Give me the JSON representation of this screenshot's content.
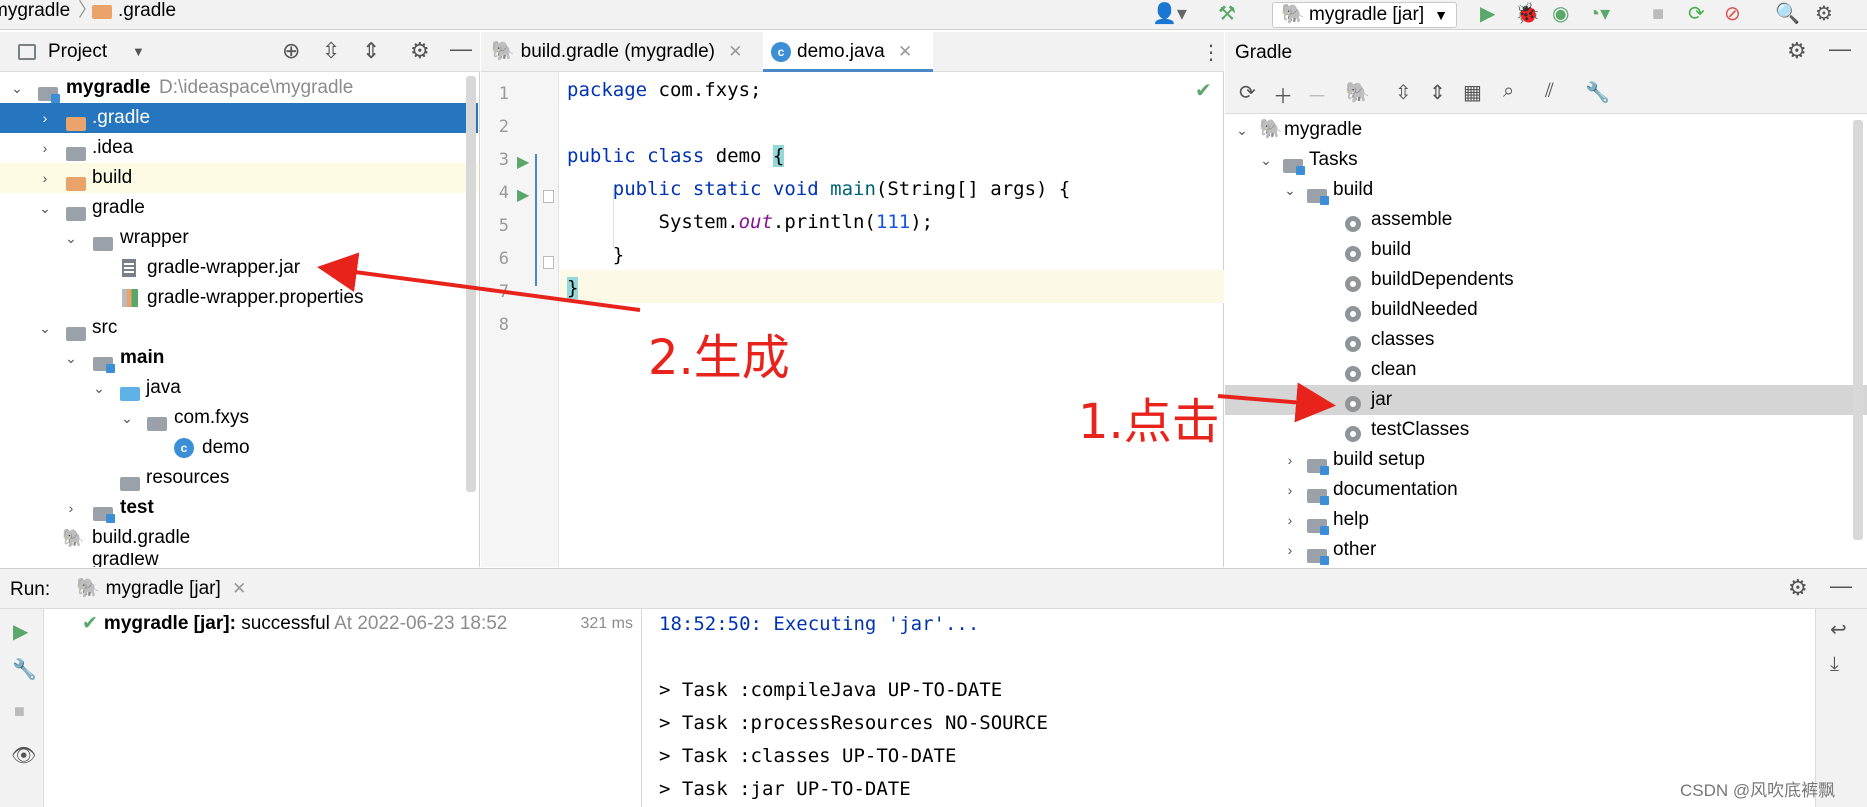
{
  "breadcrumb": {
    "project": "mygradle",
    "folder": ".gradle"
  },
  "toolbar": {
    "run_config": "mygradle [jar]"
  },
  "project_panel": {
    "title": "Project",
    "root_name": "mygradle",
    "root_path": "D:\\ideaspace\\mygradle",
    "items": [
      {
        "label": ".gradle"
      },
      {
        "label": ".idea"
      },
      {
        "label": "build"
      },
      {
        "label": "gradle"
      },
      {
        "label": "wrapper"
      },
      {
        "label": "gradle-wrapper.jar"
      },
      {
        "label": "gradle-wrapper.properties"
      },
      {
        "label": "src"
      },
      {
        "label": "main"
      },
      {
        "label": "java"
      },
      {
        "label": "com.fxys"
      },
      {
        "label": "demo"
      },
      {
        "label": "resources"
      },
      {
        "label": "test"
      },
      {
        "label": "build.gradle"
      },
      {
        "label": "gradlew"
      }
    ]
  },
  "editor": {
    "tabs": [
      {
        "label": "build.gradle (mygradle)"
      },
      {
        "label": "demo.java"
      }
    ],
    "line_numbers": [
      "1",
      "2",
      "3",
      "4",
      "5",
      "6",
      "7",
      "8"
    ]
  },
  "gradle_panel": {
    "title": "Gradle",
    "root": "mygradle",
    "tasks_label": "Tasks",
    "build_group": "build",
    "build_tasks": [
      "assemble",
      "build",
      "buildDependents",
      "buildNeeded",
      "classes",
      "clean",
      "jar",
      "testClasses"
    ],
    "other_groups": [
      "build setup",
      "documentation",
      "help",
      "other"
    ]
  },
  "run_panel": {
    "label": "Run:",
    "tab": "mygradle [jar]",
    "result_name": "mygradle [jar]:",
    "result_status": "successful",
    "result_time": "At 2022-06-23 18:52",
    "duration": "321 ms",
    "console": [
      "18:52:50: Executing 'jar'...",
      "",
      "> Task :compileJava UP-TO-DATE",
      "> Task :processResources NO-SOURCE",
      "> Task :classes UP-TO-DATE",
      "> Task :jar UP-TO-DATE"
    ]
  },
  "annotations": {
    "click": "1.点击",
    "generate": "2.生成"
  },
  "watermark": "CSDN @风吹底裤飘",
  "colors": {
    "selection": "#2675bf",
    "annotation": "#e8231c",
    "run_green": "#59a869"
  }
}
